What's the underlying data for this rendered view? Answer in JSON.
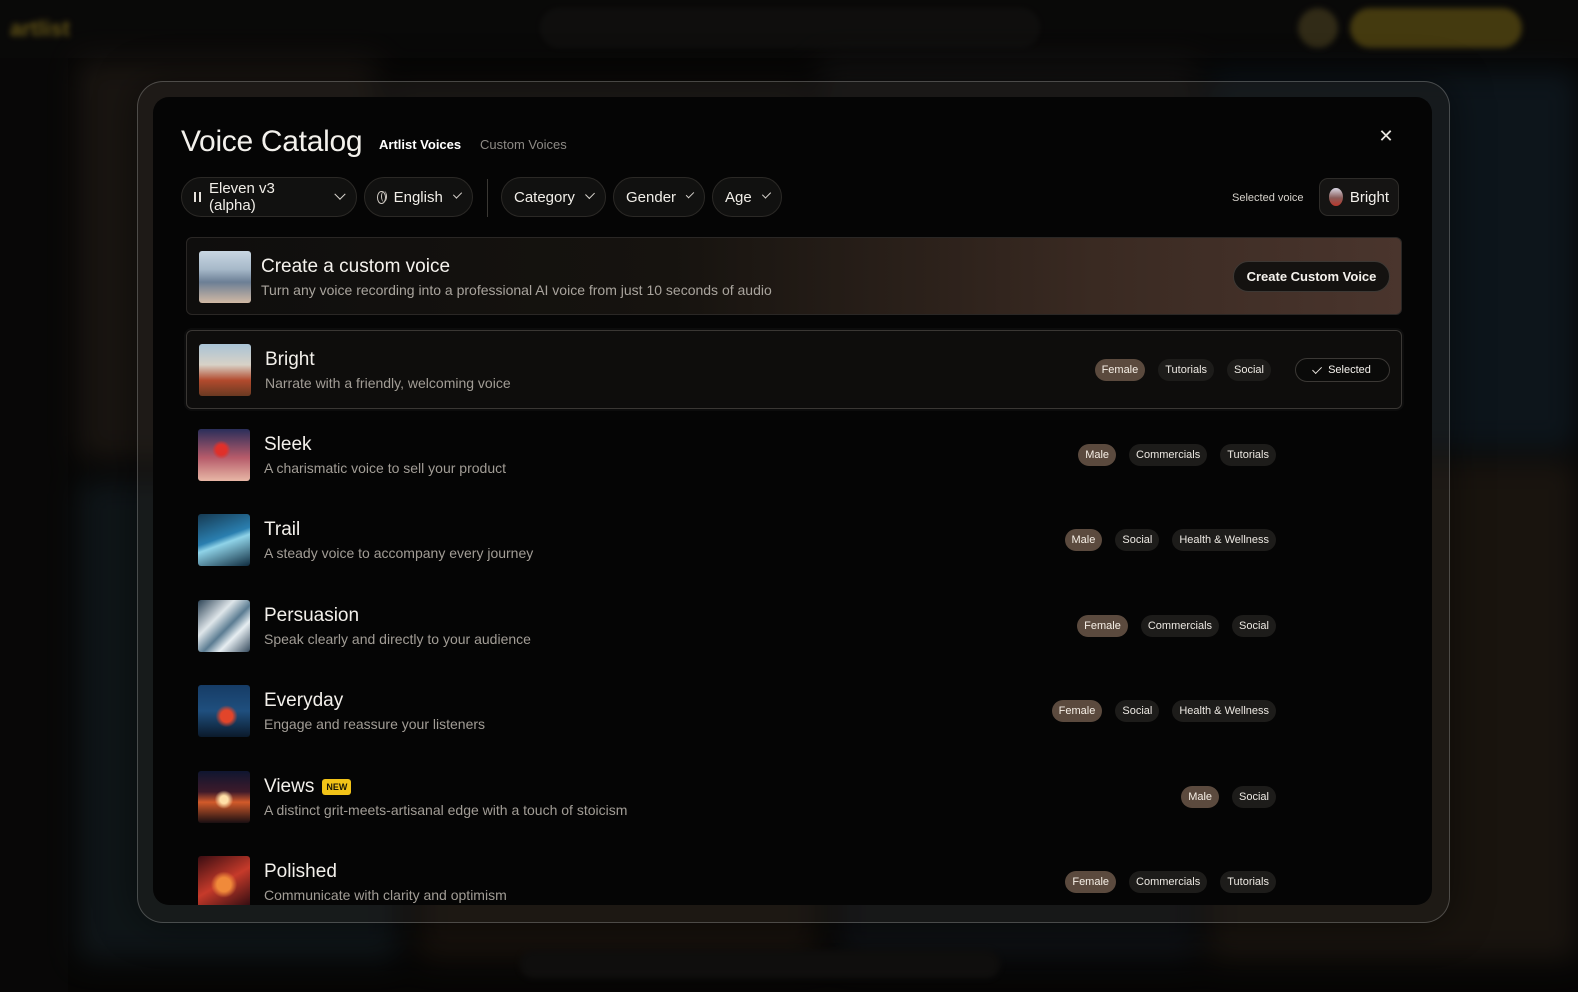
{
  "modal": {
    "title": "Voice Catalog",
    "tabs": [
      {
        "label": "Artlist Voices",
        "active": true
      },
      {
        "label": "Custom Voices",
        "active": false
      }
    ],
    "close_icon": "close-icon"
  },
  "filters": {
    "model": {
      "label": "Eleven v3 (alpha)",
      "icon": "pause-icon"
    },
    "language": {
      "label": "English",
      "icon": "globe-icon"
    },
    "category": {
      "label": "Category"
    },
    "gender": {
      "label": "Gender"
    },
    "age": {
      "label": "Age"
    }
  },
  "selected_voice": {
    "label": "Selected voice",
    "name": "Bright"
  },
  "create_banner": {
    "title": "Create a custom voice",
    "subtitle": "Turn any voice recording into a professional AI voice from just 10 seconds of audio",
    "button_label": "Create Custom Voice"
  },
  "voices": [
    {
      "name": "Bright",
      "description": "Narrate with a friendly, welcoming voice",
      "tags": [
        "Female",
        "Tutorials",
        "Social"
      ],
      "selected": true,
      "selected_label": "Selected",
      "is_new": false
    },
    {
      "name": "Sleek",
      "description": "A charismatic voice to sell your product",
      "tags": [
        "Male",
        "Commercials",
        "Tutorials"
      ],
      "selected": false,
      "is_new": false
    },
    {
      "name": "Trail",
      "description": "A steady voice to accompany every journey",
      "tags": [
        "Male",
        "Social",
        "Health & Wellness"
      ],
      "selected": false,
      "is_new": false
    },
    {
      "name": "Persuasion",
      "description": "Speak clearly and directly to your audience",
      "tags": [
        "Female",
        "Commercials",
        "Social"
      ],
      "selected": false,
      "is_new": false
    },
    {
      "name": "Everyday",
      "description": "Engage and reassure your listeners",
      "tags": [
        "Female",
        "Social",
        "Health & Wellness"
      ],
      "selected": false,
      "is_new": false
    },
    {
      "name": "Views",
      "description": "A distinct grit-meets-artisanal edge with a touch of stoicism",
      "tags": [
        "Male",
        "Social"
      ],
      "selected": false,
      "is_new": true,
      "new_label": "NEW"
    },
    {
      "name": "Polished",
      "description": "Communicate with clarity and optimism",
      "tags": [
        "Female",
        "Commercials",
        "Tutorials"
      ],
      "selected": false,
      "is_new": false
    }
  ]
}
